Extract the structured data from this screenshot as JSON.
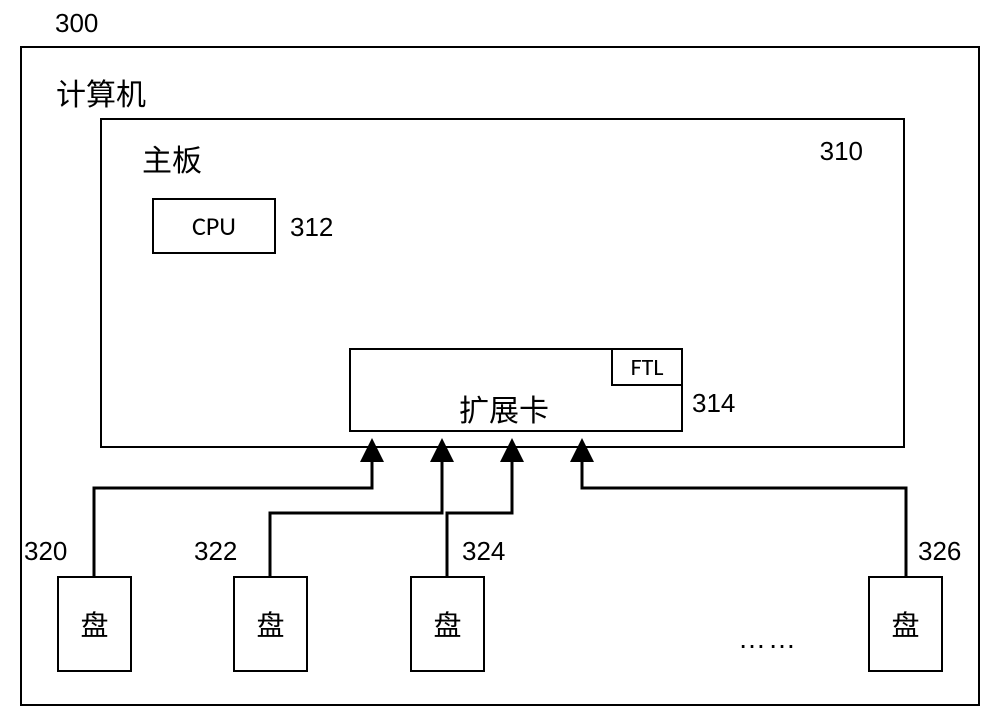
{
  "figure_num": "300",
  "computer": {
    "label": "计算机"
  },
  "mainboard": {
    "label": "主板",
    "num": "310"
  },
  "cpu": {
    "label": "CPU",
    "num": "312"
  },
  "expansion_card": {
    "label": "扩展卡",
    "num": "314",
    "ftl": "FTL"
  },
  "disks": [
    {
      "label": "盘",
      "num": "320"
    },
    {
      "label": "盘",
      "num": "322"
    },
    {
      "label": "盘",
      "num": "324"
    },
    {
      "label": "盘",
      "num": "326"
    }
  ],
  "ellipsis": "……"
}
